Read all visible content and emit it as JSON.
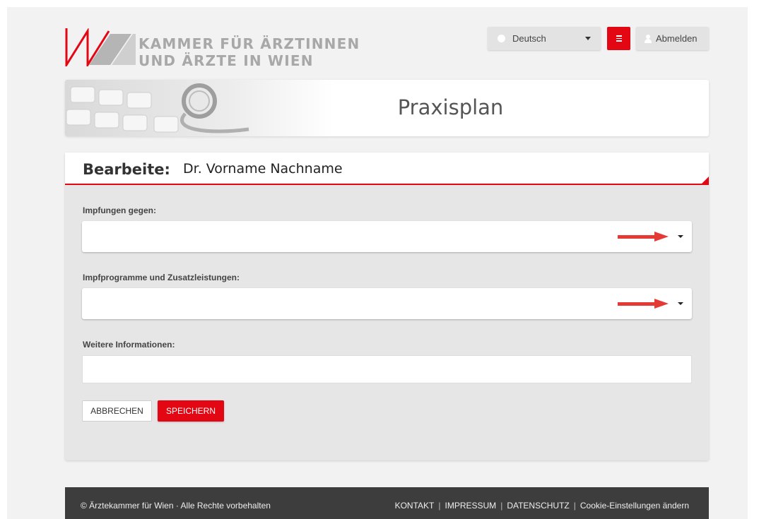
{
  "header": {
    "logo_line1": "KAMMER FÜR ÄRZTINNEN",
    "logo_line2": "UND ÄRZTE IN WIEN",
    "language": "Deutsch",
    "logout_label": "Abmelden"
  },
  "banner": {
    "title": "Praxisplan"
  },
  "form": {
    "heading_label": "Bearbeite:",
    "heading_name": "Dr. Vorname Nachname",
    "vaccinations_label": "Impfungen gegen:",
    "vaccinations_value": "",
    "programs_label": "Impfprogramme und Zusatzleistungen:",
    "programs_value": "",
    "info_label": "Weitere Informationen:",
    "info_value": "",
    "cancel_label": "ABBRECHEN",
    "save_label": "SPEICHERN"
  },
  "footer": {
    "copyright": "© Ärztekammer für Wien · Alle Rechte vorbehalten",
    "links": [
      "KONTAKT",
      "IMPRESSUM",
      "DATENSCHUTZ",
      "Cookie-Einstellungen ändern"
    ],
    "separator": "|"
  },
  "colors": {
    "accent": "#e30613",
    "annotation_arrow": "#e53935"
  }
}
